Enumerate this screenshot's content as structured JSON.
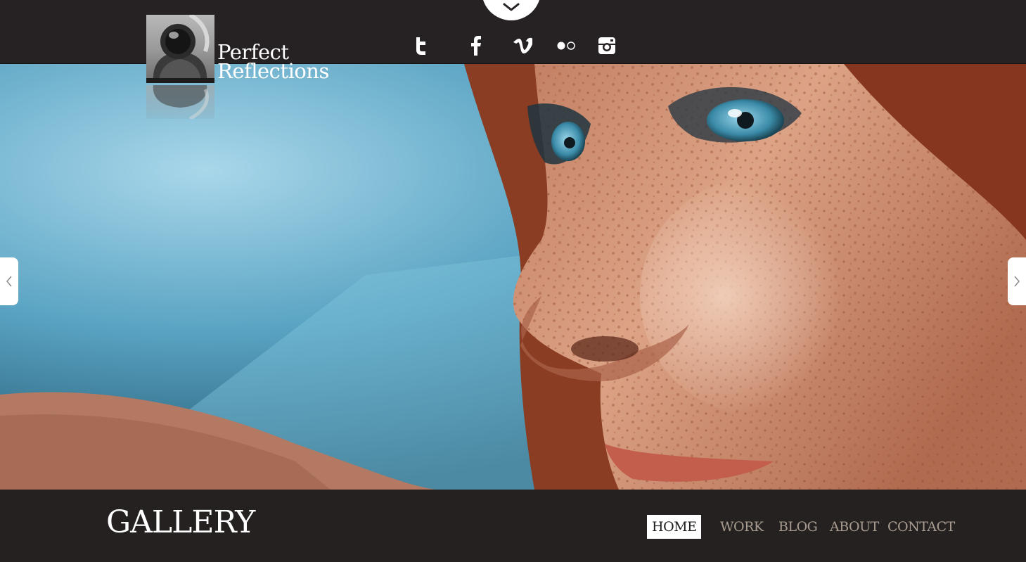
{
  "logo": {
    "line1": "Perfect",
    "line2": "Reflections"
  },
  "top_tab": {
    "icon": "chevron-down-icon"
  },
  "social": [
    {
      "name": "twitter",
      "icon": "twitter-icon"
    },
    {
      "name": "facebook",
      "icon": "facebook-icon"
    },
    {
      "name": "vimeo",
      "icon": "vimeo-icon"
    },
    {
      "name": "flickr",
      "icon": "flickr-icon"
    },
    {
      "name": "instagram",
      "icon": "instagram-icon"
    }
  ],
  "slider": {
    "prev_icon": "chevron-left-icon",
    "next_icon": "chevron-right-icon"
  },
  "page": {
    "title": "GALLERY"
  },
  "nav": [
    {
      "label": "HOME",
      "active": true
    },
    {
      "label": "WORK",
      "active": false
    },
    {
      "label": "BLOG",
      "active": false
    },
    {
      "label": "ABOUT",
      "active": false
    },
    {
      "label": "CONTACT",
      "active": false
    }
  ],
  "colors": {
    "bar_background": "#262223",
    "nav_text": "#a79c8f",
    "nav_active_bg": "#ffffff",
    "accent_white": "#ffffff"
  }
}
